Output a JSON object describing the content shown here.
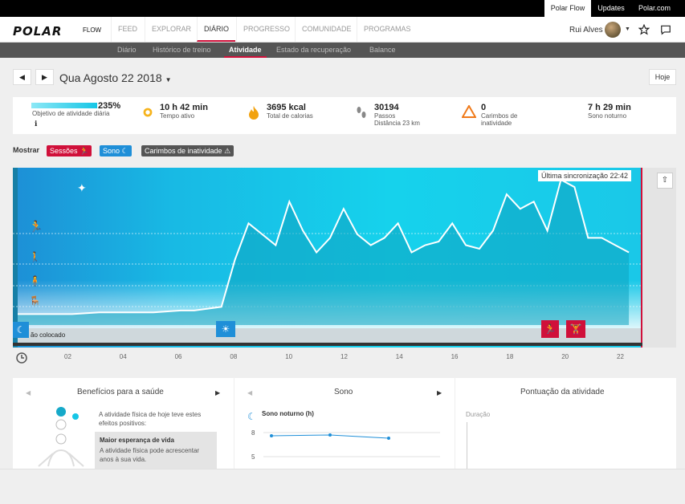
{
  "topbar": {
    "tabs": [
      "Polar Flow",
      "Updates",
      "Polar.com"
    ]
  },
  "nav": {
    "logo": "POLAR",
    "logo_suffix": "FLOW",
    "items": [
      "FEED",
      "EXPLORAR",
      "DIÁRIO",
      "PROGRESSO",
      "COMUNIDADE",
      "PROGRAMAS"
    ],
    "active": "DIÁRIO",
    "user_name": "Rui Alves"
  },
  "subnav": {
    "items": [
      "Diário",
      "Histórico de treino",
      "Atividade",
      "Estado da recuperação",
      "Balance"
    ],
    "active": "Atividade"
  },
  "date": {
    "title": "Qua Agosto 22 2018",
    "today_label": "Hoje"
  },
  "summary": {
    "goal_percent": "235%",
    "goal_label": "Objetivo de atividade diária",
    "active_time": "10 h 42 min",
    "active_time_label": "Tempo ativo",
    "calories": "3695 kcal",
    "calories_label": "Total de calorias",
    "steps": "30194",
    "steps_label": "Passos",
    "distance": "Distância 23 km",
    "inactivity_count": "0",
    "inactivity_label": "Carimbos de inatividade",
    "sleep": "7 h 29 min",
    "sleep_label": "Sono noturno"
  },
  "filters": {
    "label": "Mostrar",
    "sessions": "Sessões",
    "sleep": "Sono",
    "inactivity": "Carimbos de inatividade"
  },
  "chart": {
    "last_sync": "Última sincronização 22:42",
    "not_worn": "ão colocado",
    "x_ticks": [
      "02",
      "04",
      "06",
      "08",
      "10",
      "12",
      "14",
      "16",
      "18",
      "20",
      "22"
    ],
    "colors": {
      "session": "#d0103a",
      "sleep": "#1f8fd8",
      "bg": "#16c6e6"
    }
  },
  "chart_data": {
    "type": "area",
    "x": [
      0,
      1,
      2,
      3,
      4,
      5,
      6,
      6.5,
      7,
      7.5,
      8,
      8.5,
      9,
      9.5,
      10,
      10.5,
      11,
      11.5,
      12,
      12.5,
      13,
      13.5,
      14,
      14.5,
      15,
      15.5,
      16,
      16.5,
      17,
      17.5,
      18,
      18.5,
      19,
      19.5,
      20,
      20.5,
      21,
      21.5,
      22,
      22.5
    ],
    "values": [
      0.3,
      0.3,
      0.3,
      0.35,
      0.35,
      0.35,
      0.4,
      0.4,
      0.45,
      0.5,
      1.8,
      2.8,
      2.5,
      2.2,
      3.4,
      2.6,
      2.0,
      2.4,
      3.2,
      2.5,
      2.2,
      2.4,
      2.8,
      2.0,
      2.2,
      2.3,
      2.8,
      2.2,
      2.1,
      2.6,
      3.6,
      3.2,
      3.4,
      2.6,
      4.0,
      3.8,
      2.4,
      2.4,
      2.2,
      2.0
    ],
    "xlim": [
      0,
      23
    ]
  },
  "health": {
    "title": "Benefícios para a saúde",
    "intro": "A atividade física de hoje teve estes efeitos positivos:",
    "card_title": "Maior esperança de vida",
    "card_text": "A atividade física pode acrescentar anos à sua vida."
  },
  "sleep_panel": {
    "title": "Sono",
    "subtitle": "Sono noturno (h)",
    "y_ticks": [
      "8",
      "5"
    ],
    "values": [
      7.6,
      7.7,
      7.3
    ]
  },
  "score_panel": {
    "title": "Pontuação da atividade",
    "subtitle": "Duração"
  }
}
